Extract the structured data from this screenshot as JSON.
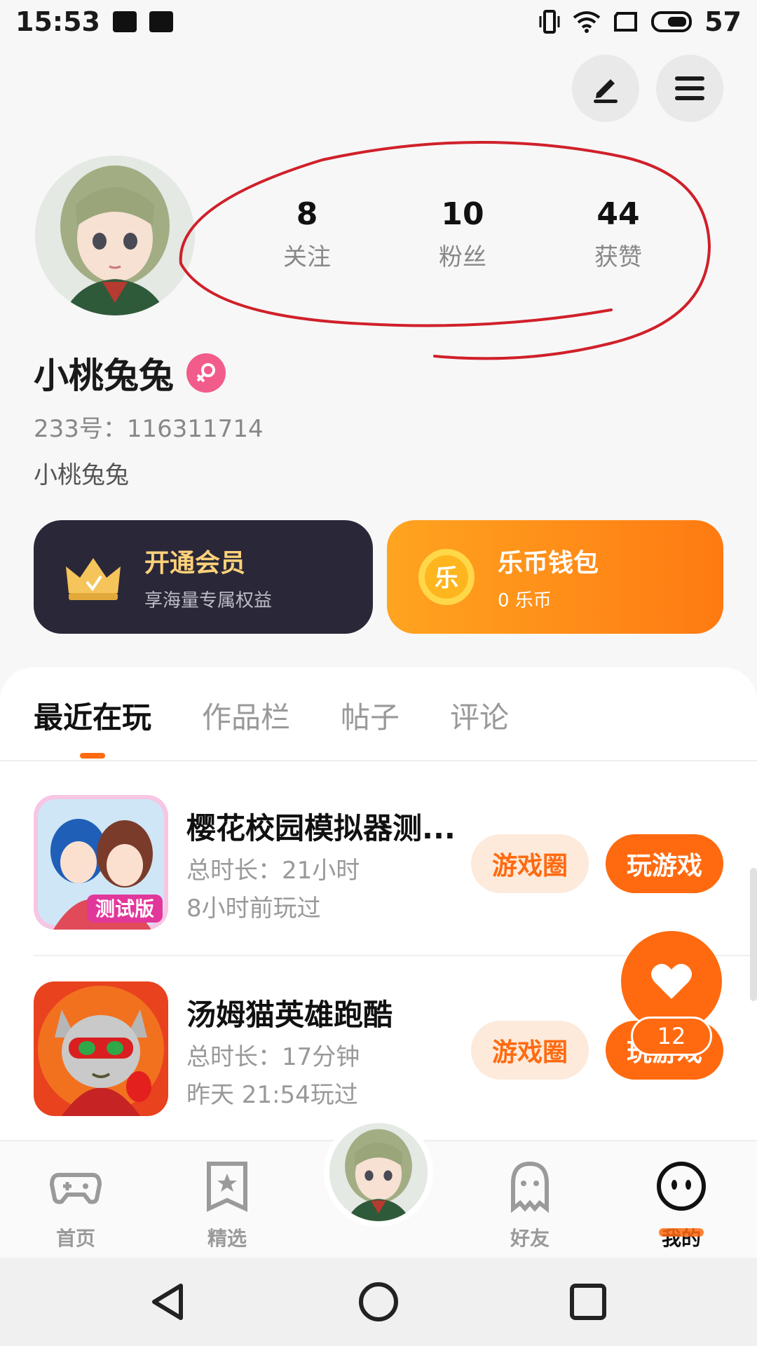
{
  "status_bar": {
    "time": "15:53",
    "battery": "57"
  },
  "profile": {
    "username": "小桃兔兔",
    "account_id": "233号：116311714",
    "bio": "小桃兔兔",
    "stats": [
      {
        "value": "8",
        "label": "关注"
      },
      {
        "value": "10",
        "label": "粉丝"
      },
      {
        "value": "44",
        "label": "获赞"
      }
    ]
  },
  "cards": {
    "vip": {
      "title": "开通会员",
      "subtitle": "享海量专属权益"
    },
    "wallet": {
      "icon_text": "乐",
      "title": "乐币钱包",
      "subtitle": "0 乐币"
    }
  },
  "tabs": [
    "最近在玩",
    "作品栏",
    "帖子",
    "评论"
  ],
  "games": [
    {
      "name": "樱花校园模拟器测...",
      "duration": "总时长：21小时",
      "last_played": "8小时前玩过",
      "icon_text": "测试版",
      "circle_label": "游戏圈",
      "play_label": "玩游戏"
    },
    {
      "name": "汤姆猫英雄跑酷",
      "duration": "总时长：17分钟",
      "last_played": "昨天 21:54玩过",
      "circle_label": "游戏圈",
      "play_label": "玩游戏"
    }
  ],
  "fab": {
    "count": "12"
  },
  "bottom_nav": [
    {
      "label": "首页",
      "icon": "gamepad-icon"
    },
    {
      "label": "精选",
      "icon": "star-icon"
    },
    {
      "label": "好友",
      "icon": "ghost-icon"
    },
    {
      "label": "我的",
      "icon": "smiley-icon",
      "active": true
    }
  ],
  "colors": {
    "accent": "#ff6a10",
    "vip_card": "#2a2838",
    "gold": "#ffd27a",
    "annotation": "#d0202a"
  }
}
